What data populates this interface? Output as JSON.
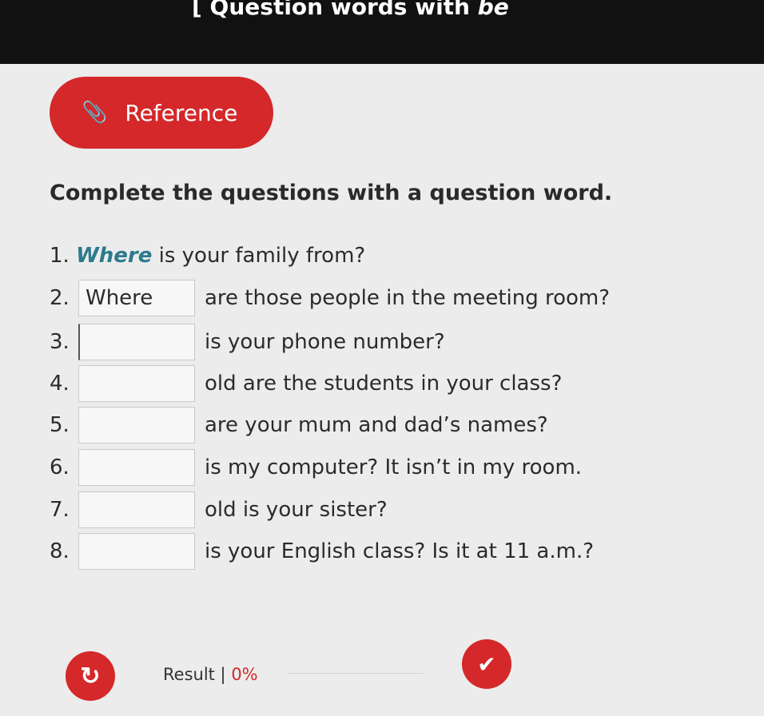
{
  "header": {
    "title_prefix": "[ Question words with ",
    "title_emphasis": "be"
  },
  "reference_button": {
    "icon": "paperclip-icon",
    "label": "Reference"
  },
  "instruction": "Complete the questions with a question word.",
  "example": {
    "number": "1.",
    "answer": "Where",
    "rest": " is your family from?"
  },
  "questions": [
    {
      "number": "2.",
      "value": "Where",
      "rest": "are those people in the meeting room?"
    },
    {
      "number": "3.",
      "value": "",
      "rest": "is your phone number?"
    },
    {
      "number": "4.",
      "value": "",
      "rest": "old are the students in your class?"
    },
    {
      "number": "5.",
      "value": "",
      "rest": "are your mum and dad’s names?"
    },
    {
      "number": "6.",
      "value": "",
      "rest": "is my computer? It isn’t in my room."
    },
    {
      "number": "7.",
      "value": "",
      "rest": "old is your sister?"
    },
    {
      "number": "8.",
      "value": "",
      "rest": "is your English class? Is it at 11 a.m.?"
    }
  ],
  "footer": {
    "reset_icon": "reset-icon",
    "result_label": "Result | ",
    "result_value": "0%",
    "check_icon": "check-icon"
  },
  "colors": {
    "accent": "#d4282b",
    "answer": "#2c7a8c",
    "topbar": "#111111"
  }
}
